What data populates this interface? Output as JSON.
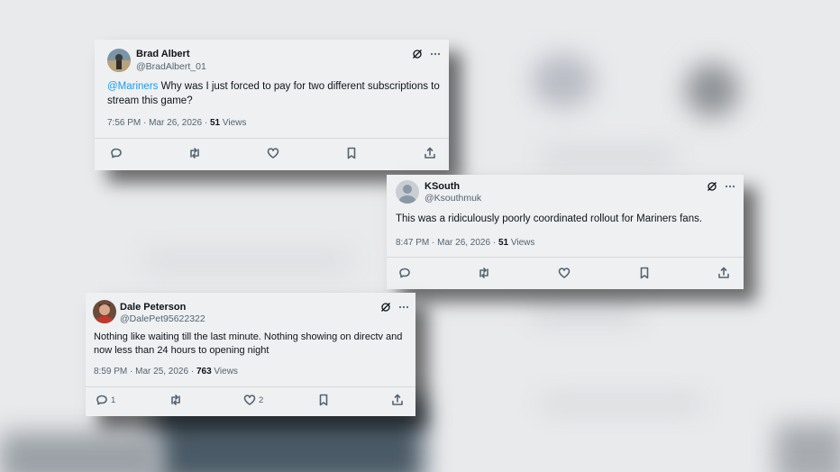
{
  "tweets": [
    {
      "name": "Brad Albert",
      "handle": "@BradAlbert_01",
      "mention": "@Mariners",
      "text": " Why was I just forced to pay for two different subscriptions to stream this game?",
      "timestamp": "7:56 PM · Mar 26, 2026 · ",
      "views_count": "51",
      "views_label": " Views",
      "reply_count": "",
      "like_count": ""
    },
    {
      "name": "KSouth",
      "handle": "@Ksouthmuk",
      "mention": "",
      "text": "This was a ridiculously poorly coordinated rollout for Mariners fans.",
      "timestamp": "8:47 PM · Mar 26, 2026 · ",
      "views_count": "51",
      "views_label": " Views",
      "reply_count": "",
      "like_count": ""
    },
    {
      "name": "Dale Peterson",
      "handle": "@DalePet95622322",
      "mention": "",
      "text": "Nothing like waiting till the last minute. Nothing showing on directv and now less than 24 hours to opening night",
      "timestamp": "8:59 PM · Mar 25, 2026 · ",
      "views_count": "763",
      "views_label": " Views",
      "reply_count": "1",
      "like_count": "2"
    }
  ],
  "icons": {
    "grok": "grok-icon",
    "more": "more-icon",
    "reply": "reply-icon",
    "retweet": "retweet-icon",
    "like": "like-icon",
    "bookmark": "bookmark-icon",
    "share": "share-icon"
  },
  "colors": {
    "mention": "#1d9bf0",
    "card_bg": "#eef0f2",
    "secondary_text": "#536471"
  }
}
